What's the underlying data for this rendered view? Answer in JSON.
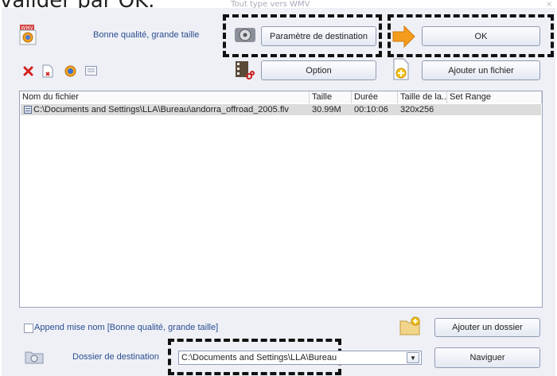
{
  "caption": "valider par OK.",
  "window": {
    "title": "Tout type vers WMV",
    "close_glyph": "×"
  },
  "profile": {
    "label": "Bonne qualité, grande taille",
    "icon": "wmv-format-icon"
  },
  "buttons": {
    "destination_settings": "Paramètre de destination",
    "ok": "OK",
    "option": "Option",
    "add_file": "Ajouter un fichier",
    "add_folder": "Ajouter un dossier",
    "browse": "Naviguer"
  },
  "toolbar": {
    "icons": [
      "delete-icon",
      "clear-icon",
      "preview-icon",
      "properties-icon"
    ]
  },
  "file_list": {
    "columns": [
      "Nom du fichier",
      "Taille",
      "Durée",
      "Taille de la...",
      "Set Range"
    ],
    "rows": [
      {
        "name": "C:\\Documents and Settings\\LLA\\Bureau\\andorra_offroad_2005.flv",
        "size": "30.99M",
        "duration": "00:10:06",
        "resolution": "320x256",
        "range": ""
      }
    ]
  },
  "append_name": {
    "label": "Append mise nom [Bonne qualité, grande taille]",
    "checked": false
  },
  "destination": {
    "label": "Dossier de destination",
    "path": "C:\\Documents and Settings\\LLA\\Bureau",
    "dropdown_glyph": "▼"
  },
  "colors": {
    "highlight_arrow": "#f59b1c",
    "delete_red": "#d42020",
    "link_blue": "#2a4d8f"
  }
}
